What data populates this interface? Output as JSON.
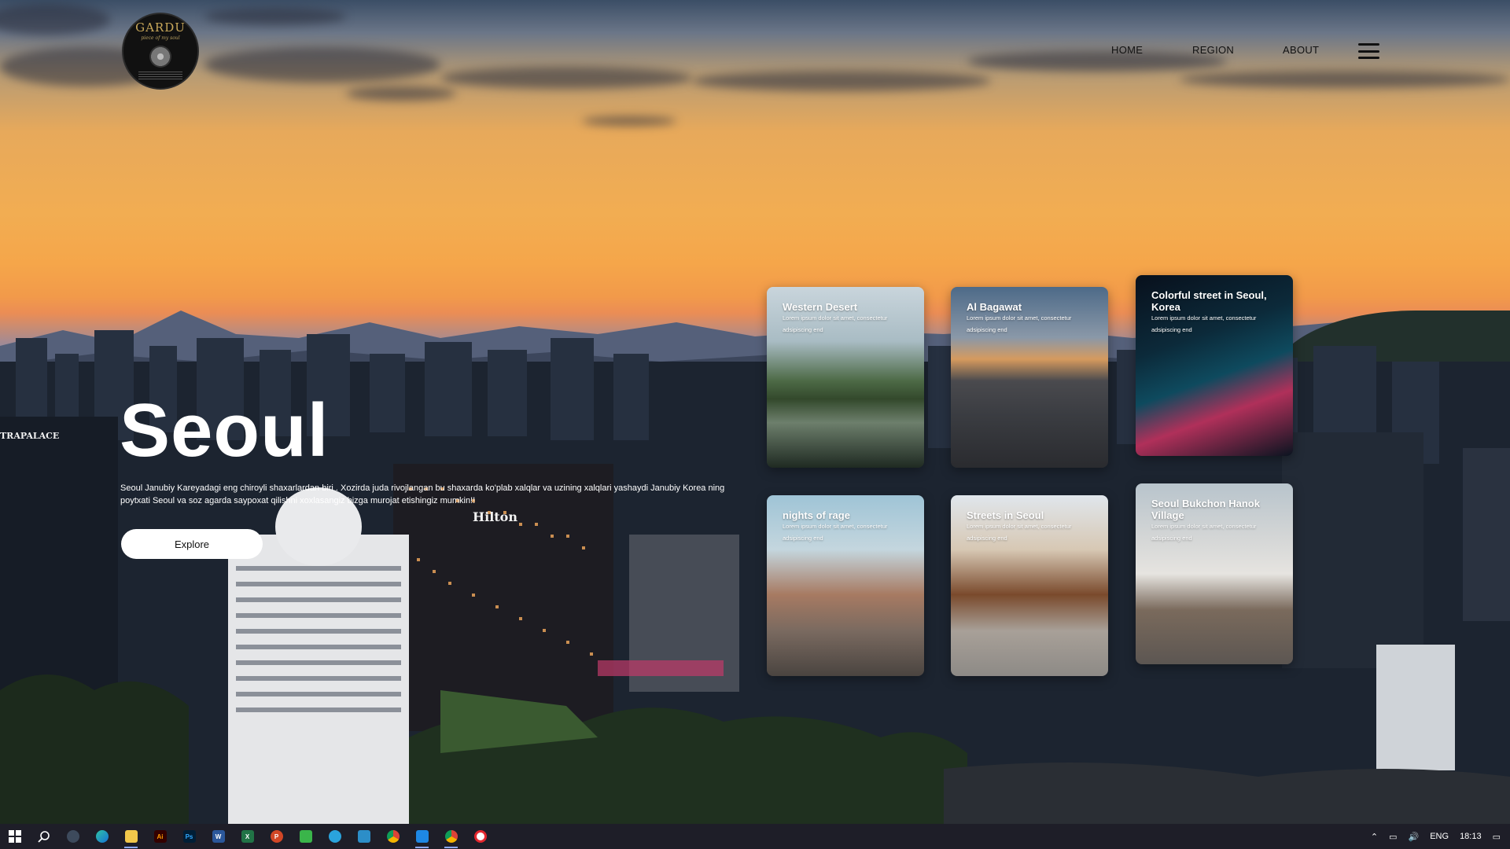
{
  "header": {
    "logo_text": "GARDU",
    "logo_subtitle": "piece of my soul",
    "nav": [
      "HOME",
      "REGION",
      "ABOUT"
    ]
  },
  "hero": {
    "title": "Seoul",
    "description": "Seoul Janubiy Kareyadagi eng chiroyli shaxarlardan biri . Xozirda juda rivojlangan bu shaxarda ko'plab xalqlar va uzining xalqlari yashaydi Janubiy Korea ning poytxati Seoul va soz agarda saypoxat qilishni xoxlasangiz bizga murojat etishingiz mumkin!!",
    "explore_label": "Explore"
  },
  "scene_signs": {
    "left": "TRAPALACE",
    "hotel": "Hilton"
  },
  "cards": [
    {
      "title": "Western Desert",
      "desc": "Lorem ipsum dolor sit amet, consectetur adsipiscing end"
    },
    {
      "title": "Al Bagawat",
      "desc": "Lorem ipsum dolor sit amet, consectetur adsipiscing end"
    },
    {
      "title": "Colorful street in Seoul, Korea",
      "desc": "Lorem ipsum dolor sit amet, consectetur adsipiscing end"
    },
    {
      "title": "nights of rage",
      "desc": "Lorem ipsum dolor sit amet, consectetur adsipiscing end"
    },
    {
      "title": "Streets in Seoul",
      "desc": "Lorem ipsum dolor sit amet, consectetur adsipiscing end"
    },
    {
      "title": "Seoul Bukchon Hanok Village",
      "desc": "Lorem ipsum dolor sit amet, consectetur adsipiscing end"
    }
  ],
  "taskbar": {
    "apps": [
      "windows-start",
      "search",
      "davinci",
      "edge",
      "file-explorer",
      "illustrator",
      "photoshop",
      "word",
      "excel",
      "powerpoint",
      "phone-link",
      "telegram",
      "3d-viewer",
      "chrome",
      "vscode",
      "chrome-profile",
      "recorder"
    ],
    "language": "ENG",
    "time": "18:13"
  },
  "colors": {
    "sky_top": "#3b4e66",
    "sky_glow": "#f2ad52",
    "button_bg": "#ffffff",
    "nav_text": "#111111"
  }
}
